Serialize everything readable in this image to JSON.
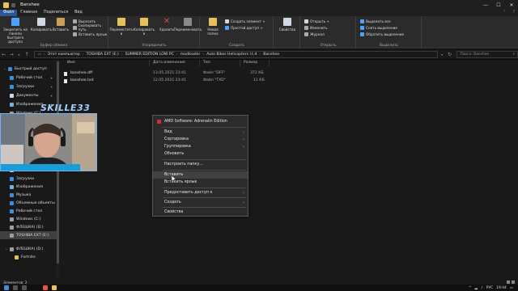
{
  "window": {
    "title": "Banshee",
    "controls": {
      "minimize": "—",
      "maximize": "☐",
      "close": "✕"
    }
  },
  "tabs": [
    "Файл",
    "Главная",
    "Поделиться",
    "Вид"
  ],
  "ribbon": {
    "pin_label": "Закрепить на панели быстрого доступа",
    "copy_label": "Копировать",
    "paste_label": "Вставить",
    "cut_label": "Вырезать",
    "copy_path_label": "Скопировать путь",
    "paste_shortcut_label": "Вставить ярлык",
    "clipboard_group": "Буфер обмена",
    "move_to_label": "Переместить в",
    "copy_to_label": "Копировать в",
    "delete_label": "Удалить",
    "rename_label": "Переименовать",
    "organize_group": "Упорядочить",
    "new_folder_label": "Новая папка",
    "new_item_label": "Создать элемент",
    "easy_access_label": "Простой доступ",
    "new_group": "Создать",
    "properties_label": "Свойства",
    "open_label": "Открыть",
    "edit_label": "Изменить",
    "history_label": "Журнал",
    "open_group": "Открыть",
    "select_all_label": "Выделить все",
    "select_none_label": "Снять выделение",
    "invert_selection_label": "Обратить выделение",
    "select_group": "Выделить"
  },
  "address": {
    "crumbs": [
      "Этот компьютер",
      "TOSHIBA EXT (E:)",
      "SUMMER EDITION LOW PC",
      "modloader",
      "Auto Bikes Helicopters l.t.d",
      "Banshee"
    ],
    "search_placeholder": "Поиск: Banshee"
  },
  "navpane": {
    "items": [
      {
        "label": "Быстрый доступ",
        "icon": "star-icon",
        "color": "#3b8ee0",
        "pinned": false
      },
      {
        "label": "Рабочий стол",
        "icon": "desktop-icon",
        "color": "#3b8ee0",
        "pinned": true
      },
      {
        "label": "Загрузки",
        "icon": "download-icon",
        "color": "#3b8ee0",
        "pinned": true
      },
      {
        "label": "Документы",
        "icon": "document-icon",
        "color": "#cfd8e3",
        "pinned": true
      },
      {
        "label": "Изображения",
        "icon": "image-icon",
        "color": "#6fb3e0",
        "pinned": true
      },
      {
        "label": "Windows (C:)",
        "icon": "drive-icon",
        "color": "#9aa0a6",
        "pinned": true
      },
      {
        "label": "Документы",
        "icon": "document-icon",
        "color": "#cfd8e3",
        "pinned": false
      },
      {
        "label": "Загрузки",
        "icon": "download-icon",
        "color": "#3b8ee0",
        "pinned": false
      },
      {
        "label": "Изображения",
        "icon": "image-icon",
        "color": "#6fb3e0",
        "pinned": false
      },
      {
        "label": "Музыка",
        "icon": "music-icon",
        "color": "#3b8ee0",
        "pinned": false
      },
      {
        "label": "Объемные объекты",
        "icon": "cube-icon",
        "color": "#3b8ee0",
        "pinned": false
      },
      {
        "label": "Рабочий стол",
        "icon": "desktop-icon",
        "color": "#3b8ee0",
        "pinned": false
      },
      {
        "label": "Windows (C:)",
        "icon": "drive-icon",
        "color": "#9aa0a6",
        "pinned": false
      },
      {
        "label": "ФЛЕШКА) (D:)",
        "icon": "usb-drive-icon",
        "color": "#9aa0a6",
        "pinned": false
      },
      {
        "label": "TOSHIBA EXT (E:)",
        "icon": "drive-icon",
        "color": "#9aa0a6",
        "pinned": false
      },
      {
        "label": "ФЛЕШКА) (D:)",
        "icon": "usb-drive-icon",
        "color": "#9aa0a6",
        "pinned": false
      },
      {
        "label": "Fortnite",
        "icon": "folder-icon",
        "color": "#e8c15a",
        "pinned": false
      }
    ]
  },
  "filelist": {
    "columns": [
      "Имя",
      "Дата изменения",
      "Тип",
      "Размер"
    ],
    "rows": [
      {
        "name": "banshee.dff",
        "date": "13.05.2021 23:41",
        "type": "Файл \"DFF\"",
        "size": "372 КБ"
      },
      {
        "name": "banshee.txd",
        "date": "12.05.2021 23:41",
        "type": "Файл \"TXD\"",
        "size": "11 КБ"
      }
    ]
  },
  "webcam": {
    "name": "SKILLE33"
  },
  "context_menu": {
    "items": [
      {
        "label": "AMD Software: Adrenalin Edition",
        "icon": "amd-icon",
        "submenu": false,
        "sep_after": true
      },
      {
        "label": "Вид",
        "submenu": true,
        "sep_after": false
      },
      {
        "label": "Сортировка",
        "submenu": true,
        "sep_after": false
      },
      {
        "label": "Группировка",
        "submenu": true,
        "sep_after": false
      },
      {
        "label": "Обновить",
        "submenu": false,
        "sep_after": true
      },
      {
        "label": "Настроить папку...",
        "submenu": false,
        "sep_after": true
      },
      {
        "label": "Вставить",
        "submenu": false,
        "sep_after": false,
        "hover": true
      },
      {
        "label": "Вставить ярлык",
        "submenu": false,
        "sep_after": true
      },
      {
        "label": "Предоставить доступ к",
        "submenu": true,
        "sep_after": true
      },
      {
        "label": "Создать",
        "submenu": true,
        "sep_after": true
      },
      {
        "label": "Свойства",
        "submenu": false,
        "sep_after": false
      }
    ]
  },
  "status": {
    "count": "Элементов: 2"
  },
  "taskbar": {
    "lang": "РУС",
    "time": "19:44"
  }
}
